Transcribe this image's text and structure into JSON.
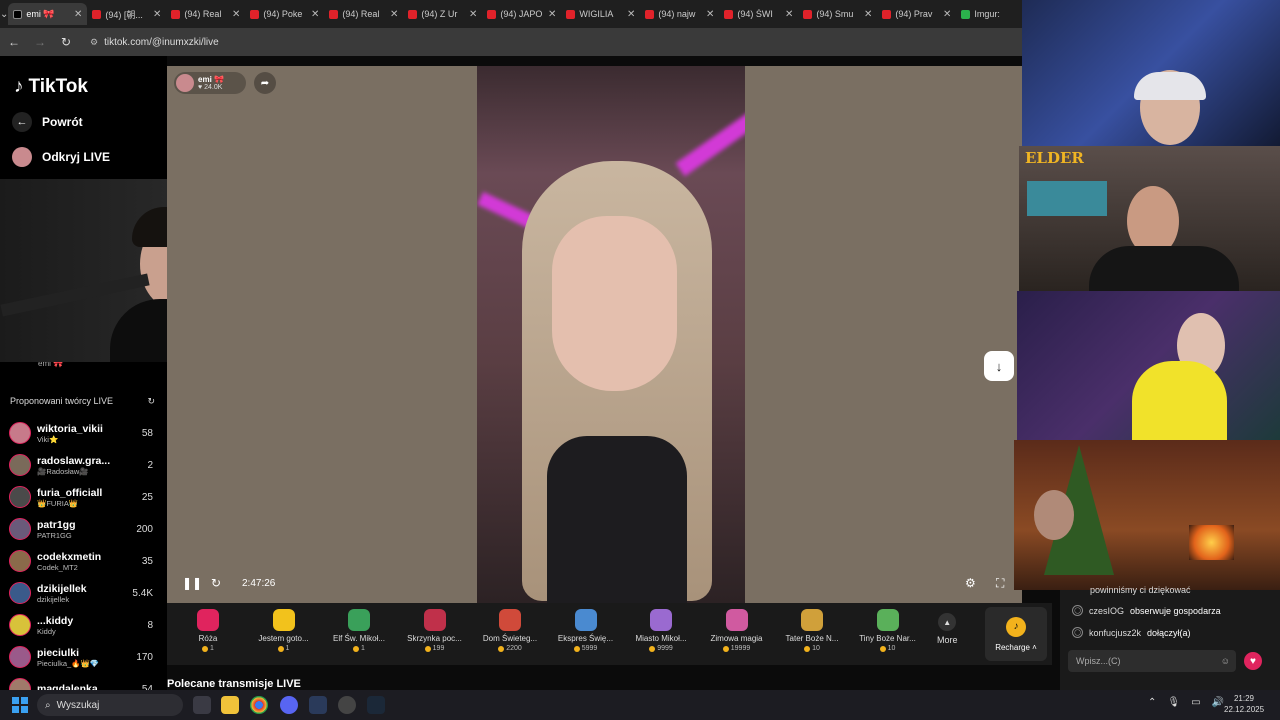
{
  "browser": {
    "tabs": [
      {
        "label": "emi 🎀",
        "type": "tiktok",
        "active": true
      },
      {
        "label": "(94) [朝...",
        "type": "yt"
      },
      {
        "label": "(94) Real",
        "type": "yt"
      },
      {
        "label": "(94) Poke",
        "type": "yt"
      },
      {
        "label": "(94) Real",
        "type": "yt"
      },
      {
        "label": "(94) Z Ur",
        "type": "yt"
      },
      {
        "label": "(94) JAPO",
        "type": "yt"
      },
      {
        "label": "WIGILIA",
        "type": "yt"
      },
      {
        "label": "(94) najw",
        "type": "yt"
      },
      {
        "label": "(94) ŚWI",
        "type": "yt"
      },
      {
        "label": "(94) Smu",
        "type": "yt"
      },
      {
        "label": "(94) Prav",
        "type": "yt"
      },
      {
        "label": "Imgur:",
        "type": "img"
      }
    ],
    "url": "tiktok.com/@inumxzki/live"
  },
  "sidebar": {
    "brand": "TikTok",
    "back_label": "Powrót",
    "discover_label": "Odkryj LIVE",
    "hidden_name": "emi 🎀",
    "suggested_heading": "Proponowani twórcy LIVE",
    "creators": [
      {
        "name": "wiktoria_vikii",
        "sub": "Viki⭐",
        "count": "58",
        "color": "#c77a8a"
      },
      {
        "name": "radoslaw.gra...",
        "sub": "🎥Radosław🎥",
        "count": "2",
        "color": "#7a6a5a"
      },
      {
        "name": "furia_officiall",
        "sub": "👑FURIA👑",
        "count": "25",
        "color": "#4a4a4a"
      },
      {
        "name": "patr1gg",
        "sub": "PATR1GG",
        "count": "200",
        "color": "#6a5a7a"
      },
      {
        "name": "codekxmetin",
        "sub": "Codek_MT2",
        "count": "35",
        "color": "#8a6a4a"
      },
      {
        "name": "dzikijellek",
        "sub": "dzikijellek",
        "count": "5.4K",
        "color": "#3a5a8a"
      },
      {
        "name": "...kiddy",
        "sub": "Kiddy",
        "count": "8",
        "color": "#d8c23a"
      },
      {
        "name": "pieciulki",
        "sub": "Pieciulka_🔥👑💎",
        "count": "170",
        "color": "#9a5a8a"
      },
      {
        "name": "magdalenka_...",
        "sub": "",
        "count": "54",
        "color": "#a07a6a"
      }
    ]
  },
  "stream": {
    "host_name": "emi 🎀",
    "host_likes": "24.0K",
    "elapsed": "2:47:26"
  },
  "gifts": [
    {
      "name": "Róża",
      "price": "1",
      "color": "#e0245e"
    },
    {
      "name": "Jestem goto...",
      "price": "1",
      "color": "#f2c21c"
    },
    {
      "name": "Elf Św. Mikoł...",
      "price": "1",
      "color": "#3aa05a"
    },
    {
      "name": "Skrzynka poc...",
      "price": "199",
      "color": "#c0304a"
    },
    {
      "name": "Dom Świeteg...",
      "price": "2200",
      "color": "#d04a3a"
    },
    {
      "name": "Ekspres Świę...",
      "price": "5999",
      "color": "#4a8ad0"
    },
    {
      "name": "Miasto Mikoł...",
      "price": "9999",
      "color": "#9a6ad0"
    },
    {
      "name": "Zimowa magia",
      "price": "19999",
      "color": "#d05aa0"
    },
    {
      "name": "Tater Boże N...",
      "price": "10",
      "color": "#d0a03a"
    },
    {
      "name": "Tiny Boże Nar...",
      "price": "10",
      "color": "#5ab05a"
    }
  ],
  "more_label": "More",
  "recharge_label": "Recharge",
  "recommended_heading": "Polecane transmisje LIVE",
  "cams": {
    "cam2_label": "ELDER"
  },
  "chat": {
    "cut_line": "powinniśmy ci dziękować",
    "lines": [
      {
        "user": "czesIOG",
        "msg": "obserwuje gospodarza"
      },
      {
        "user": "konfucjusz2k",
        "msg": "dołączył(a)"
      }
    ],
    "input_placeholder": "Wpisz...(C)"
  },
  "taskbar": {
    "search_label": "Wyszukaj",
    "time": "21:29",
    "date": "22.12.2025"
  }
}
